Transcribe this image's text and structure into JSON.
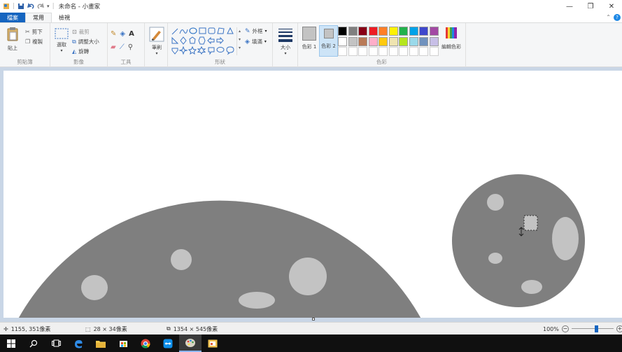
{
  "window": {
    "title": "未命名 - 小畫家",
    "minimize": "—",
    "maximize": "❐",
    "close": "✕"
  },
  "tabs": [
    {
      "label": "檔案"
    },
    {
      "label": "常用"
    },
    {
      "label": "檢視"
    }
  ],
  "help_glyph": "?",
  "ribbon": {
    "clipboard": {
      "label": "剪貼簿",
      "paste": "貼上",
      "cut": "剪下",
      "copy": "複製"
    },
    "image": {
      "label": "影像",
      "select": "選取",
      "crop": "裁剪",
      "resize": "調整大小",
      "rotate": "旋轉"
    },
    "tools": {
      "label": "工具"
    },
    "brushes": {
      "label": "筆刷"
    },
    "shapes": {
      "label": "形狀",
      "outline": "外框",
      "fill": "填滿"
    },
    "size": {
      "label": "大小"
    },
    "colors": {
      "label": "色彩",
      "color1": "色彩 1",
      "color2": "色彩 2",
      "edit": "編輯色彩",
      "palette_row1": [
        "#000000",
        "#7f7f7f",
        "#880015",
        "#ed1c24",
        "#ff7f27",
        "#fff200",
        "#22b14c",
        "#00a2e8",
        "#3f48cc",
        "#a349a4"
      ],
      "palette_row2": [
        "#ffffff",
        "#c3c3c3",
        "#b97a57",
        "#ffaec9",
        "#ffc90e",
        "#efe4b0",
        "#b5e61d",
        "#99d9ea",
        "#7092be",
        "#c8bfe7"
      ],
      "color1_value": "#c3c3c3",
      "color2_value": "#c3c3c3"
    }
  },
  "status": {
    "cursor_pos": "1155, 351像素",
    "selection_size": "28 × 34像素",
    "canvas_size": "1354 × 545像素",
    "zoom": "100%",
    "zoom_level_fraction": 0.6
  },
  "colors": {
    "planet": "#7f7f7f",
    "crater": "#c3c3c3",
    "accent": "#1565c0"
  }
}
